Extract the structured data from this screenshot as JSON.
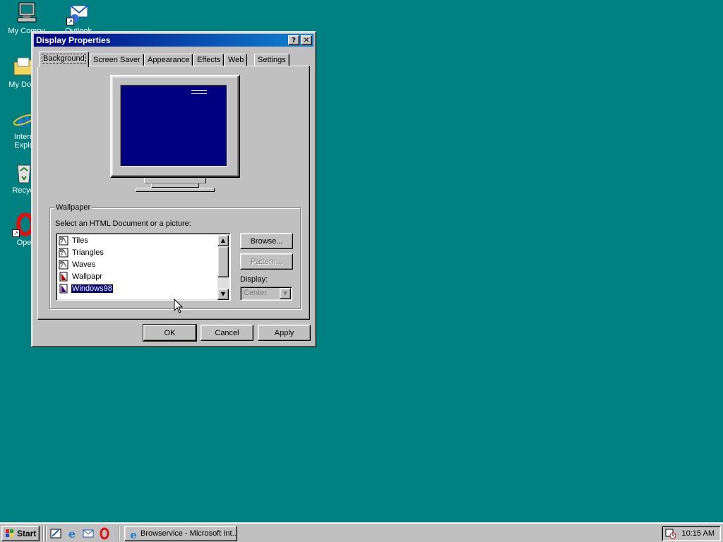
{
  "desktop": {
    "icons": [
      {
        "label": "My Computer",
        "visible_label": "My Compu"
      },
      {
        "label": "Outlook",
        "visible_label": "Outlook"
      },
      {
        "label": "My Documents",
        "visible_label": "My Docu"
      },
      {
        "label": "Internet Explorer",
        "visible_label_1": "Intern",
        "visible_label_2": "Explo"
      },
      {
        "label": "Recycle Bin",
        "visible_label": "Recycl"
      },
      {
        "label": "Opera",
        "visible_label": "Ope"
      }
    ]
  },
  "dialog": {
    "title": "Display Properties",
    "help_glyph": "?",
    "close_glyph": "✕",
    "tabs": [
      "Background",
      "Screen Saver",
      "Appearance",
      "Effects",
      "Web",
      "Settings"
    ],
    "active_tab": "Background",
    "wallpaper": {
      "legend": "Wallpaper",
      "select_label": "Select an HTML Document or a picture:",
      "items": [
        {
          "label": "Tiles",
          "type": "bmp"
        },
        {
          "label": "Triangles",
          "type": "bmp"
        },
        {
          "label": "Waves",
          "type": "bmp"
        },
        {
          "label": "Wallpapr",
          "type": "html"
        },
        {
          "label": "Windows98",
          "type": "html",
          "selected": true
        }
      ],
      "scroll_up": "▲",
      "scroll_down": "▼",
      "browse_label": "Browse...",
      "pattern_label": "Pattern...",
      "display_label": "Display:",
      "display_value": "Center",
      "display_arrow": "▼"
    },
    "buttons": {
      "ok": "OK",
      "cancel": "Cancel",
      "apply": "Apply"
    }
  },
  "taskbar": {
    "start_label": "Start",
    "task_label": "Browservice - Microsoft Int...",
    "clock": "10:15 AM"
  },
  "colors": {
    "desktop": "#008080",
    "title_start": "#000080",
    "title_end": "#1084d0",
    "face": "#c0c0c0",
    "selection": "#000080"
  }
}
